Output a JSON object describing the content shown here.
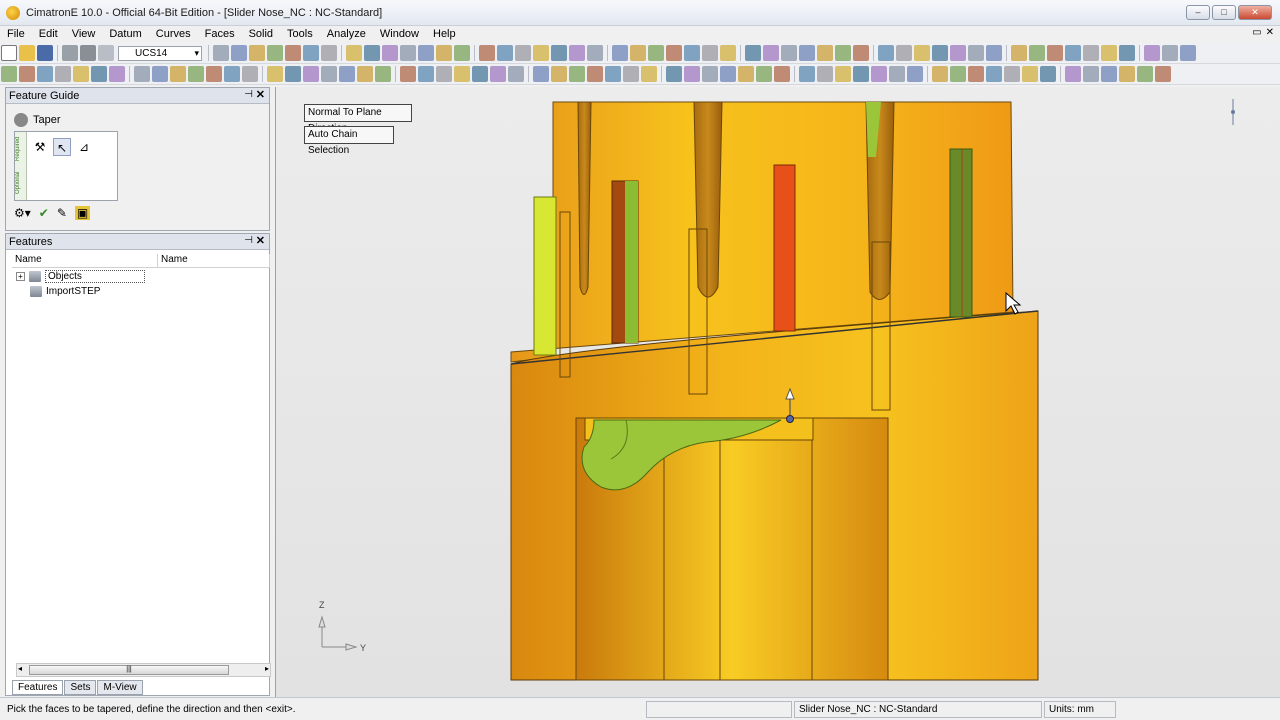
{
  "window": {
    "title": "CimatronE 10.0 - Official 64-Bit Edition - [Slider Nose_NC : NC-Standard]",
    "min": "–",
    "max": "□",
    "close": "✕",
    "mdi_restore": "▭",
    "mdi_close": "✕"
  },
  "menu": [
    "File",
    "Edit",
    "View",
    "Datum",
    "Curves",
    "Faces",
    "Solid",
    "Tools",
    "Analyze",
    "Window",
    "Help"
  ],
  "toolbar": {
    "ucs_value": "UCS14"
  },
  "feature_guide": {
    "header": "Feature Guide",
    "title": "Taper",
    "tab_required": "Required",
    "tab_optional": "Optional"
  },
  "features_panel": {
    "header": "Features",
    "col_name1": "Name",
    "col_name2": "Name",
    "items": [
      {
        "label": "Objects"
      },
      {
        "label": "ImportSTEP"
      }
    ],
    "tabs": [
      "Features",
      "Sets",
      "M-View"
    ]
  },
  "viewport": {
    "btn_normal": "Normal To Plane Direction",
    "btn_chain": "Auto Chain Selection",
    "axis_z": "Z",
    "axis_y": "Y"
  },
  "status": {
    "message": "Pick the faces to be tapered, define the direction and then <exit>.",
    "doc": "Slider Nose_NC : NC-Standard",
    "units": "Units: mm"
  },
  "colors": {
    "part_orange": "#f0a21a",
    "part_yellow": "#f6c81e",
    "face_green": "#9bc63a",
    "face_red": "#e8501a"
  }
}
